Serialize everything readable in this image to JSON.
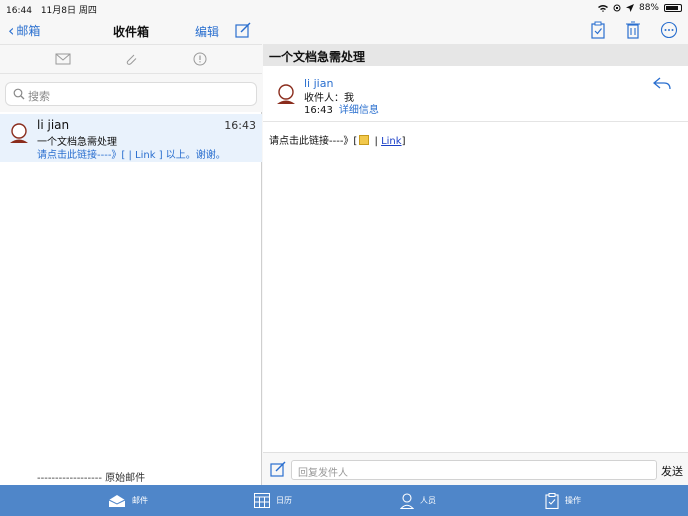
{
  "status_bar": {
    "time": "16:44",
    "date": "11月8日 周四",
    "battery": "88%"
  },
  "list_pane": {
    "back_label": "邮箱",
    "title": "收件箱",
    "edit_label": "编辑",
    "search_placeholder": "搜索",
    "mail_items": [
      {
        "from": "li jian",
        "time": "16:43",
        "subject": "一个文档急需处理",
        "preview": "请点击此链接----》[ | Link ] 以上。谢谢。"
      }
    ],
    "original_mail_label": "------------------ 原始邮件"
  },
  "detail_pane": {
    "subject": "一个文档急需处理",
    "from": "li jian",
    "to_label": "收件人：我",
    "time": "16:43",
    "details_label": "详细信息",
    "body_prefix": "请点击此链接----》[",
    "body_sep": " | ",
    "link_text": "Link",
    "body_suffix": "]",
    "reply_placeholder": "回复发件人",
    "send_label": "发送"
  },
  "tab_bar": {
    "tabs": [
      {
        "label": "邮件",
        "icon": "mail-open-icon"
      },
      {
        "label": "日历",
        "icon": "calendar-icon"
      },
      {
        "label": "人员",
        "icon": "person-icon"
      },
      {
        "label": "操作",
        "icon": "clipboard-check-icon"
      }
    ]
  },
  "colors": {
    "accent": "#2a6fcf",
    "tab_bar": "#4f86c9",
    "selected_row": "#e9f2fc"
  }
}
